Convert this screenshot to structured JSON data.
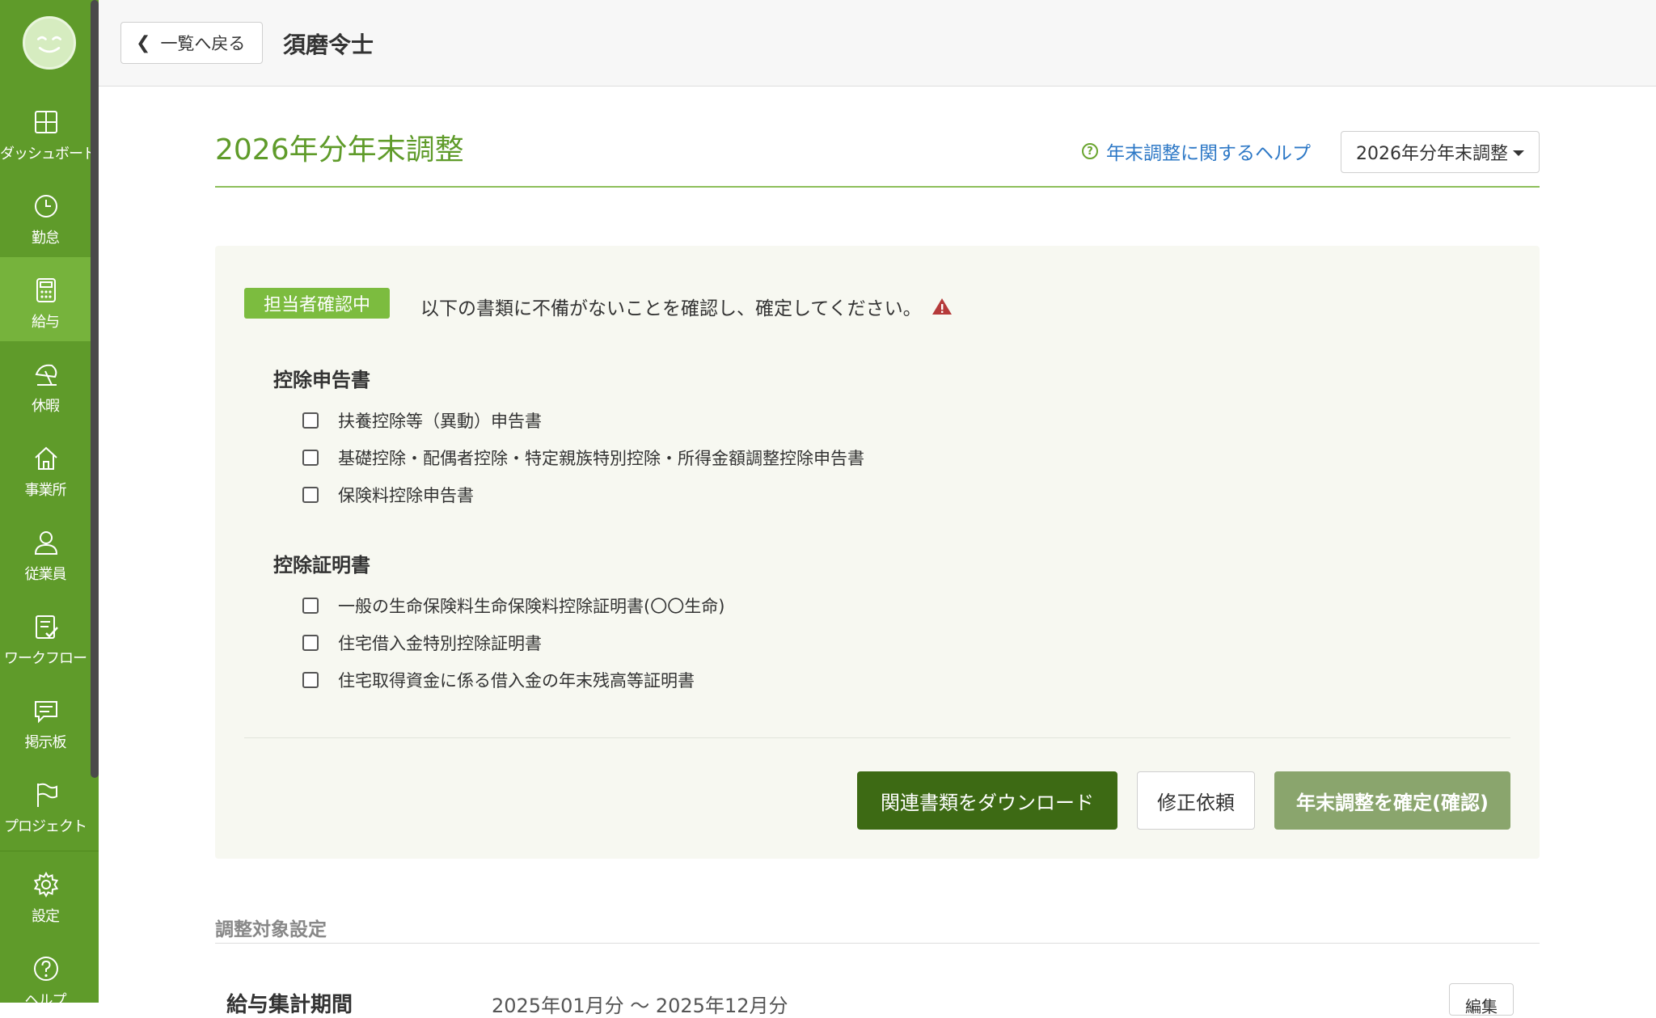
{
  "sidebar": {
    "items": [
      {
        "label": "ダッシュボード",
        "icon": "dashboard-icon"
      },
      {
        "label": "勤怠",
        "icon": "clock-icon"
      },
      {
        "label": "給与",
        "icon": "calculator-icon"
      },
      {
        "label": "休暇",
        "icon": "beach-umbrella-icon"
      },
      {
        "label": "事業所",
        "icon": "home-icon"
      },
      {
        "label": "従業員",
        "icon": "person-icon"
      },
      {
        "label": "ワークフロー",
        "icon": "checklist-icon"
      },
      {
        "label": "掲示板",
        "icon": "chat-icon"
      },
      {
        "label": "プロジェクト",
        "icon": "flag-icon"
      }
    ],
    "bottom": [
      {
        "label": "設定",
        "icon": "gear-icon"
      },
      {
        "label": "ヘルプ",
        "icon": "help-icon"
      }
    ]
  },
  "header": {
    "back_label": "一覧へ戻る",
    "title": "須磨令士"
  },
  "main": {
    "title": "2026年分年末調整",
    "help_link": "年末調整に関するヘルプ",
    "year_select": "2026年分年末調整",
    "status_badge": "担当者確認中",
    "status_message": "以下の書類に不備がないことを確認し、確定してください。",
    "sections": [
      {
        "title": "控除申告書",
        "items": [
          "扶養控除等（異動）申告書",
          "基礎控除・配偶者控除・特定親族特別控除・所得金額調整控除申告書",
          "保険料控除申告書"
        ]
      },
      {
        "title": "控除証明書",
        "items": [
          "一般の生命保険料生命保険料控除証明書(〇〇生命)",
          "住宅借入金特別控除証明書",
          "住宅取得資金に係る借入金の年末残高等証明書"
        ]
      }
    ],
    "buttons": {
      "download": "関連書類をダウンロード",
      "request": "修正依頼",
      "confirm": "年末調整を確定(確認)"
    },
    "settings": {
      "title": "調整対象設定",
      "row_label": "給与集計期間",
      "row_value": "2025年01月分 ～ 2025年12月分",
      "edit": "編集"
    }
  },
  "colors": {
    "sidebar": "#5f9b2a",
    "sidebar_active": "#76b33c",
    "accent": "#5f9b2a",
    "link": "#2d78c6",
    "badge": "#7cbc3f",
    "primary_button": "#3d6a14",
    "confirm_button": "#8aa56d",
    "warning": "#b53a3a"
  }
}
